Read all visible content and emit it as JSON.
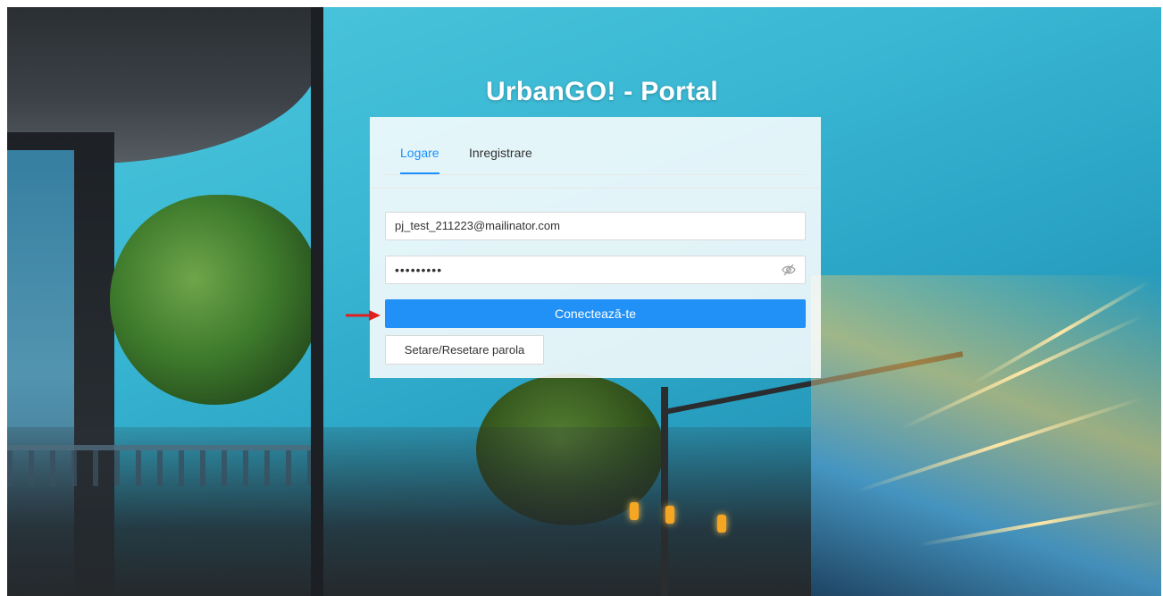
{
  "page": {
    "title": "UrbanGO! - Portal"
  },
  "tabs": [
    {
      "label": "Logare",
      "active": true
    },
    {
      "label": "Inregistrare",
      "active": false
    }
  ],
  "form": {
    "email_value": "pj_test_211223@mailinator.com",
    "password_mask": "•••••••••",
    "password_toggle_icon": "eye-slash-icon",
    "login_label": "Conectează-te",
    "reset_label": "Setare/Resetare parola"
  },
  "annotation": {
    "arrow_icon": "red-arrow-icon",
    "arrow_color": "#e02020"
  },
  "colors": {
    "primary": "#2190f7",
    "active_tab": "#1890ff"
  }
}
